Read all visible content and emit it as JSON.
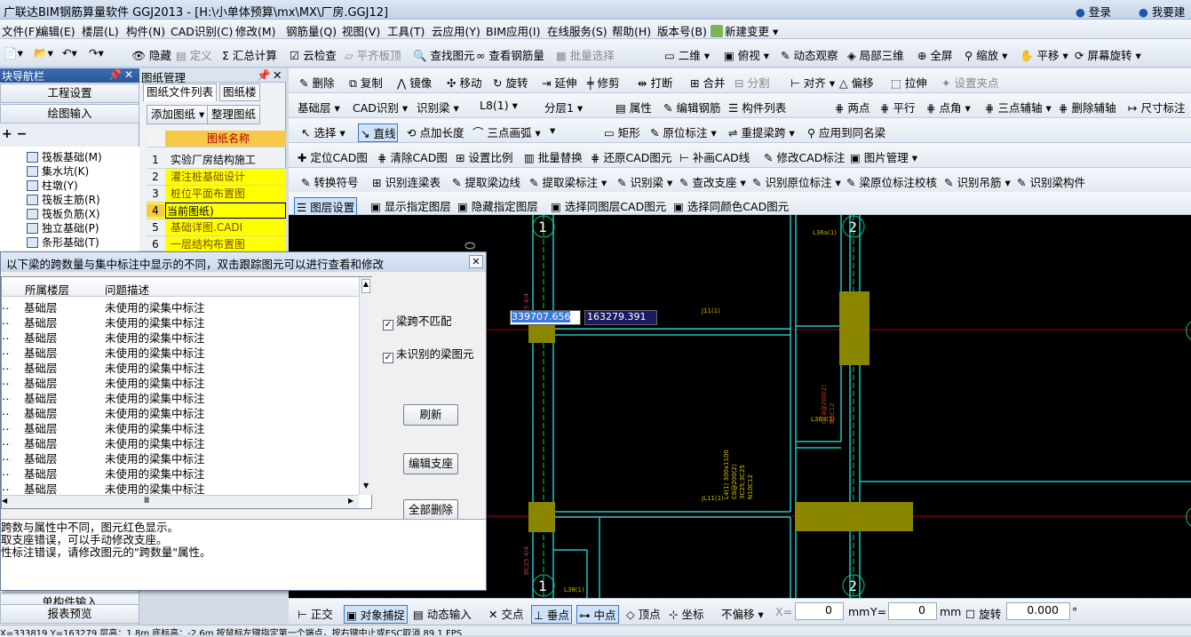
{
  "title": "广联达BIM钢筋算量软件 GGJ2013 - [H:\\小单体预算\\mx\\MX\\厂房.GGJ12]",
  "user": {
    "login": "登录",
    "suggest": "我要建议"
  },
  "menu": [
    "文件(F)",
    "编辑(E)",
    "楼层(L)",
    "构件(N)",
    "CAD识别(C)",
    "修改(M)",
    "钢筋量(Q)",
    "视图(V)",
    "工具(T)",
    "云应用(Y)",
    "BIM应用(I)",
    "在线服务(S)",
    "帮助(H)",
    "版本号(B)",
    "新建变更"
  ],
  "toolbar1": [
    "隐藏",
    "定义",
    "汇总计算",
    "云检查",
    "平齐板顶",
    "查找图元",
    "查看钢筋量",
    "批量选择",
    "二维",
    "俯视",
    "动态观察",
    "局部三维",
    "全屏",
    "缩放",
    "平移",
    "屏幕旋转"
  ],
  "toolbar2": [
    "删除",
    "复制",
    "镜像",
    "移动",
    "旋转",
    "延伸",
    "修剪",
    "打断",
    "合并",
    "分割",
    "对齐",
    "偏移",
    "拉伸",
    "设置夹点"
  ],
  "toolbar3": {
    "floor": "基础层",
    "cad": "CAD识别",
    "ident": "识别梁",
    "comp": "L8(1)",
    "layer": "分层1",
    "items": [
      "属性",
      "编辑钢筋",
      "构件列表",
      "两点",
      "平行",
      "点角",
      "三点辅轴",
      "删除辅轴",
      "尺寸标注"
    ]
  },
  "toolbar4": [
    "选择",
    "直线",
    "点加长度",
    "三点画弧",
    "矩形",
    "原位标注",
    "重提梁跨",
    "应用到同名梁"
  ],
  "toolbar5": [
    "定位CAD图",
    "清除CAD图",
    "设置比例",
    "批量替换",
    "还原CAD图元",
    "补画CAD线",
    "修改CAD标注",
    "图片管理"
  ],
  "toolbar6": [
    "转换符号",
    "识别连梁表",
    "提取梁边线",
    "提取梁标注",
    "识别梁",
    "查改支座",
    "识别原位标注",
    "梁原位标注校核",
    "识别吊筋",
    "识别梁构件"
  ],
  "toolbar7": [
    "图层设置",
    "显示指定图层",
    "隐藏指定图层",
    "选择同图层CAD图元",
    "选择同颜色CAD图元"
  ],
  "nav": {
    "header": "块导航栏",
    "proj": "工程设置",
    "draw": "绘图输入",
    "items": [
      "筏板基础(M)",
      "集水坑(K)",
      "柱墩(Y)",
      "筏板主筋(R)",
      "筏板负筋(X)",
      "独立基础(P)",
      "条形基础(T)"
    ],
    "single": "单构件输入",
    "report": "报表预览"
  },
  "drawmgmt": {
    "header": "图纸管理",
    "tab1": "图纸文件列表",
    "tab2": "图纸楼",
    "add": "添加图纸",
    "arrange": "整理图纸",
    "col": "图纸名称",
    "rows": [
      [
        "1",
        "实验厂房结构施工"
      ],
      [
        "2",
        "灌注桩基础设计"
      ],
      [
        "3",
        "桩位平面布置图"
      ],
      [
        "4",
        "当前图纸)"
      ],
      [
        "5",
        "基础详图.CADI"
      ],
      [
        "6",
        "一层结构布置图"
      ]
    ]
  },
  "dialog": {
    "title": "以下梁的跨数量与集中标注中显示的不同，双击跟踪图元可以进行查看和修改",
    "col1": "所属楼层",
    "col2": "问题描述",
    "rows": [
      [
        "基础层",
        "未使用的梁集中标注"
      ],
      [
        "基础层",
        "未使用的梁集中标注"
      ],
      [
        "基础层",
        "未使用的梁集中标注"
      ],
      [
        "基础层",
        "未使用的梁集中标注"
      ],
      [
        "基础层",
        "未使用的梁集中标注"
      ],
      [
        "基础层",
        "未使用的梁集中标注"
      ],
      [
        "基础层",
        "未使用的梁集中标注"
      ],
      [
        "基础层",
        "未使用的梁集中标注"
      ],
      [
        "基础层",
        "未使用的梁集中标注"
      ],
      [
        "基础层",
        "未使用的梁集中标注"
      ],
      [
        "基础层",
        "未使用的梁集中标注"
      ],
      [
        "基础层",
        "未使用的梁集中标注"
      ],
      [
        "基础层",
        "未使用的梁集中标注"
      ],
      [
        "基础层",
        "未使用的梁集中标注"
      ]
    ],
    "chk1": "梁跨不匹配",
    "chk2": "未识别的梁图元",
    "refresh": "刷新",
    "edit": "编辑支座",
    "delall": "全部删除",
    "notes": [
      "跨数与属性中不同，图元红色显示。",
      "取支座错误，可以手动修改支座。",
      "性标注错误，请修改图元的\"跨数量\"属性。"
    ]
  },
  "coords": {
    "x": "339707.656",
    "y": "163279.391"
  },
  "canvas_text": {
    "axis1": "1",
    "axis2": "2",
    "l1": "J11(1)",
    "l2": "L36a(1)",
    "l3": "L36a(1)",
    "l4": "JL11(1)",
    "l5": "L4(1) 300x1100",
    "l6": "C8@200(2)",
    "l7": "3C25;3C25",
    "l8": "N10C12",
    "l9": "L38(1)",
    "l10": "BC25 4/4",
    "l11": "C10@200(2)",
    "l12": "N6C12",
    "l13": "010"
  },
  "bottom": {
    "items": [
      "正交",
      "对象捕捉",
      "动态输入",
      "交点",
      "垂点",
      "中点",
      "顶点",
      "坐标"
    ],
    "offset": "不偏移",
    "xlabel": "X=",
    "xval": "0",
    "mm1": "mm",
    "ylabel": "Y=",
    "yval": "0",
    "mm2": "mm",
    "rot": "旋转",
    "rotval": "0.000"
  },
  "status": "X=333819  Y=163279      层高：1.8m      底标高：-2.6m        按鼠标左键指定第一个端点，按右键中止或ESC取消                                                     89.1 FPS"
}
